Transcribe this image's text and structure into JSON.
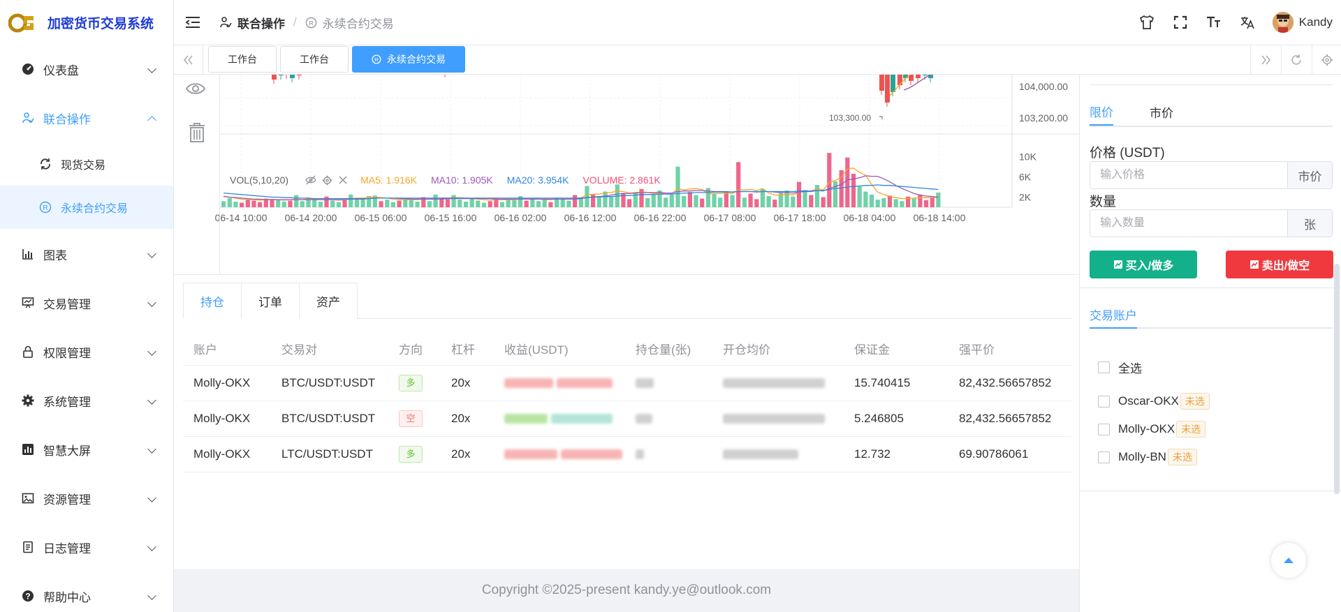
{
  "app": {
    "title": "加密货币交易系统"
  },
  "sidebar": {
    "items": [
      {
        "label": "仪表盘",
        "icon": "dashboard-icon"
      },
      {
        "label": "联合操作",
        "icon": "operation-icon"
      },
      {
        "label": "图表",
        "icon": "chart-icon"
      },
      {
        "label": "交易管理",
        "icon": "trade-icon"
      },
      {
        "label": "权限管理",
        "icon": "lock-icon"
      },
      {
        "label": "系统管理",
        "icon": "gear-icon"
      },
      {
        "label": "智慧大屏",
        "icon": "bar-screen-icon"
      },
      {
        "label": "资源管理",
        "icon": "image-icon"
      },
      {
        "label": "日志管理",
        "icon": "log-icon"
      },
      {
        "label": "帮助中心",
        "icon": "help-icon"
      }
    ],
    "subitems": [
      {
        "label": "现货交易",
        "icon": "sync-icon"
      },
      {
        "label": "永续合约交易",
        "icon": "registered-icon"
      }
    ]
  },
  "header": {
    "breadcrumb": [
      "联合操作",
      "永续合约交易"
    ],
    "username": "Kandy"
  },
  "tabs": [
    "工作台",
    "工作台",
    "永续合约交易"
  ],
  "chart": {
    "price_ticks": [
      "104,000.00",
      "103,200.00"
    ],
    "low_marker": "103,300.00",
    "vol_ticks": [
      "10K",
      "6K",
      "2K"
    ],
    "time_ticks": [
      "06-14 10:00",
      "06-14 20:00",
      "06-15 06:00",
      "06-15 16:00",
      "06-16 02:00",
      "06-16 12:00",
      "06-16 22:00",
      "06-17 08:00",
      "06-17 18:00",
      "06-18 04:00",
      "06-18 14:00"
    ],
    "vol_legend": {
      "name": "VOL(5,10,20)",
      "ma5": "MA5: 1.916K",
      "ma10": "MA10: 1.905K",
      "ma20": "MA20: 3.954K",
      "volume": "VOLUME: 2.861K"
    },
    "colors": {
      "up": "#26a69a",
      "down": "#ef5350",
      "ma5": "#f5a623",
      "ma10": "#9b59b6",
      "ma20": "#2e86de"
    }
  },
  "chart_data": {
    "type": "bar",
    "title": "",
    "xlabel": "",
    "ylabel": "",
    "x_range": [
      "06-14 10:00",
      "06-18 14:00"
    ],
    "ylim": [
      0,
      11000
    ],
    "series": [
      {
        "name": "VOLUME",
        "values": [
          1200,
          1800,
          1100,
          900,
          1500,
          1300,
          1000,
          1700,
          1400,
          1600,
          1100,
          1300,
          2400,
          1200,
          1900,
          1500,
          1100,
          2100,
          1300,
          1000,
          1400,
          2500,
          1800,
          1600,
          2200,
          2300,
          1200,
          1500,
          1000,
          1300,
          1700,
          1400,
          1100,
          2000,
          1200,
          2500,
          1900,
          1600,
          2400,
          1500,
          1100,
          1700,
          1300,
          900,
          1200,
          1800,
          1000,
          1600,
          1400,
          2200,
          1300,
          1700,
          1200,
          1500,
          1000,
          1900,
          1600,
          1300,
          2400,
          1800,
          4200,
          2500,
          1900,
          3100,
          2100,
          4500,
          2800,
          1600,
          2900,
          3600,
          1800,
          2400,
          3300,
          1900,
          2500,
          8000,
          2200,
          3000,
          2400,
          1700,
          3800,
          2600,
          1900,
          3000,
          2400,
          8900,
          1900,
          2700,
          1600,
          3600,
          2200,
          1500,
          2800,
          3300,
          2100,
          5000,
          3400,
          2400,
          4400,
          2000,
          10700,
          5100,
          7300,
          9800,
          6600,
          4100,
          3100,
          2500,
          1500,
          1800,
          2300,
          1600,
          1200,
          2100,
          1700,
          2500,
          1400,
          1900,
          2900
        ]
      },
      {
        "name": "MA5",
        "values": [
          2200,
          2000,
          1800,
          1600,
          1500,
          1500,
          1400,
          1500,
          1600,
          1500,
          1400,
          1500,
          1600,
          1500,
          1700,
          1600,
          1500,
          1600,
          1500,
          1400,
          1500,
          1700,
          1800,
          1800,
          1900,
          2000,
          1900,
          1800,
          1600,
          1500,
          1500,
          1500,
          1500,
          1600,
          1600,
          1800,
          1800,
          1800,
          1900,
          1900,
          1800,
          1700,
          1600,
          1500,
          1400,
          1500,
          1500,
          1500,
          1500,
          1600,
          1600,
          1600,
          1600,
          1500,
          1500,
          1600,
          1600,
          1600,
          1700,
          1900,
          2400,
          2600,
          2600,
          2800,
          2900,
          3200,
          3100,
          2800,
          2900,
          3000,
          2900,
          2700,
          2800,
          2600,
          2600,
          3700,
          3400,
          3600,
          3700,
          3500,
          2600,
          2700,
          2700,
          2800,
          2700,
          3500,
          3400,
          3500,
          3300,
          3700,
          2800,
          2400,
          2300,
          2600,
          2400,
          3000,
          3200,
          3200,
          3700,
          3400,
          4900,
          5300,
          5900,
          7600,
          7700,
          6900,
          6300,
          4500,
          3000,
          2500,
          2100,
          1900,
          1700,
          1700,
          1800,
          1900,
          1900,
          1900,
          2000
        ]
      },
      {
        "name": "MA10",
        "values": [
          2100,
          2000,
          1900,
          1800,
          1700,
          1600,
          1600,
          1500,
          1500,
          1500,
          1500,
          1500,
          1500,
          1500,
          1500,
          1500,
          1500,
          1500,
          1500,
          1500,
          1500,
          1600,
          1600,
          1600,
          1700,
          1800,
          1800,
          1800,
          1800,
          1700,
          1700,
          1600,
          1600,
          1600,
          1600,
          1600,
          1600,
          1700,
          1700,
          1700,
          1700,
          1700,
          1700,
          1700,
          1700,
          1600,
          1600,
          1600,
          1600,
          1600,
          1600,
          1600,
          1600,
          1600,
          1600,
          1600,
          1600,
          1600,
          1600,
          1700,
          1900,
          2000,
          2100,
          2200,
          2400,
          2600,
          2700,
          2700,
          2800,
          2900,
          2900,
          2900,
          2900,
          2800,
          2800,
          3100,
          3200,
          3200,
          3300,
          3300,
          3200,
          3100,
          3100,
          3100,
          3000,
          3100,
          3100,
          3100,
          3000,
          3100,
          3100,
          3000,
          2900,
          2900,
          2800,
          3000,
          3100,
          3100,
          3300,
          3200,
          3700,
          4100,
          4500,
          5400,
          5600,
          5800,
          6200,
          6100,
          6100,
          5600,
          5000,
          4300,
          3700,
          3200,
          2700,
          2400,
          2200,
          2100,
          2000
        ]
      },
      {
        "name": "MA20",
        "values": [
          2800,
          2700,
          2600,
          2500,
          2400,
          2300,
          2200,
          2100,
          2000,
          2000,
          1900,
          1900,
          1800,
          1800,
          1800,
          1700,
          1700,
          1700,
          1700,
          1700,
          1700,
          1700,
          1700,
          1700,
          1700,
          1800,
          1800,
          1800,
          1800,
          1800,
          1800,
          1800,
          1800,
          1800,
          1800,
          1800,
          1800,
          1800,
          1800,
          1800,
          1800,
          1800,
          1800,
          1800,
          1800,
          1800,
          1800,
          1800,
          1800,
          1800,
          1800,
          1800,
          1800,
          1800,
          1800,
          1800,
          1800,
          1800,
          1800,
          1800,
          1900,
          2000,
          2000,
          2100,
          2100,
          2200,
          2300,
          2300,
          2400,
          2500,
          2500,
          2500,
          2600,
          2600,
          2600,
          2700,
          2800,
          2800,
          2900,
          2900,
          2900,
          3000,
          3000,
          3000,
          3000,
          3100,
          3100,
          3100,
          3100,
          3100,
          3100,
          3100,
          3100,
          3100,
          3100,
          3200,
          3200,
          3200,
          3300,
          3300,
          3500,
          3700,
          3800,
          4000,
          4100,
          4200,
          4300,
          4300,
          4400,
          4300,
          4300,
          4200,
          4100,
          4000,
          3900,
          3800,
          3700,
          3600,
          3500
        ]
      }
    ]
  },
  "positions": {
    "tabs": [
      "持仓",
      "订单",
      "资产"
    ],
    "columns": [
      "账户",
      "交易对",
      "方向",
      "杠杆",
      "收益(USDT)",
      "持仓量(张)",
      "开仓均价",
      "保证金",
      "强平价"
    ],
    "rows": [
      {
        "account": "Molly-OKX",
        "pair": "BTC/USDT:USDT",
        "direction": "多",
        "dir_type": "long",
        "leverage": "20x",
        "profit_color": "#f8b4b4",
        "margin": "15.740415",
        "liq_price": "82,432.56657852"
      },
      {
        "account": "Molly-OKX",
        "pair": "BTC/USDT:USDT",
        "direction": "空",
        "dir_type": "short",
        "leverage": "20x",
        "profit_color": "#b8e5c4",
        "margin": "5.246805",
        "liq_price": "82,432.56657852"
      },
      {
        "account": "Molly-OKX",
        "pair": "LTC/USDT:USDT",
        "direction": "多",
        "dir_type": "long",
        "leverage": "20x",
        "profit_color": "#f8b4b4",
        "margin": "12.732",
        "liq_price": "69.90786061"
      }
    ]
  },
  "order_form": {
    "tabs": [
      "限价",
      "市价"
    ],
    "price_label": "价格 (USDT)",
    "price_placeholder": "输入价格",
    "price_suffix": "市价",
    "qty_label": "数量",
    "qty_placeholder": "输入数量",
    "qty_suffix": "张",
    "buy_label": "买入/做多",
    "sell_label": "卖出/做空",
    "buy_color": "#13b08a",
    "sell_color": "#f0393e"
  },
  "accounts": {
    "tab": "交易账户",
    "select_all": "全选",
    "items": [
      {
        "name": "Oscar-OKX",
        "badge": "未选"
      },
      {
        "name": "Molly-OKX",
        "badge": "未选"
      },
      {
        "name": "Molly-BN",
        "badge": "未选"
      }
    ]
  },
  "footer": {
    "copyright": "Copyright ©2025-present kandy.ye@outlook.com"
  }
}
